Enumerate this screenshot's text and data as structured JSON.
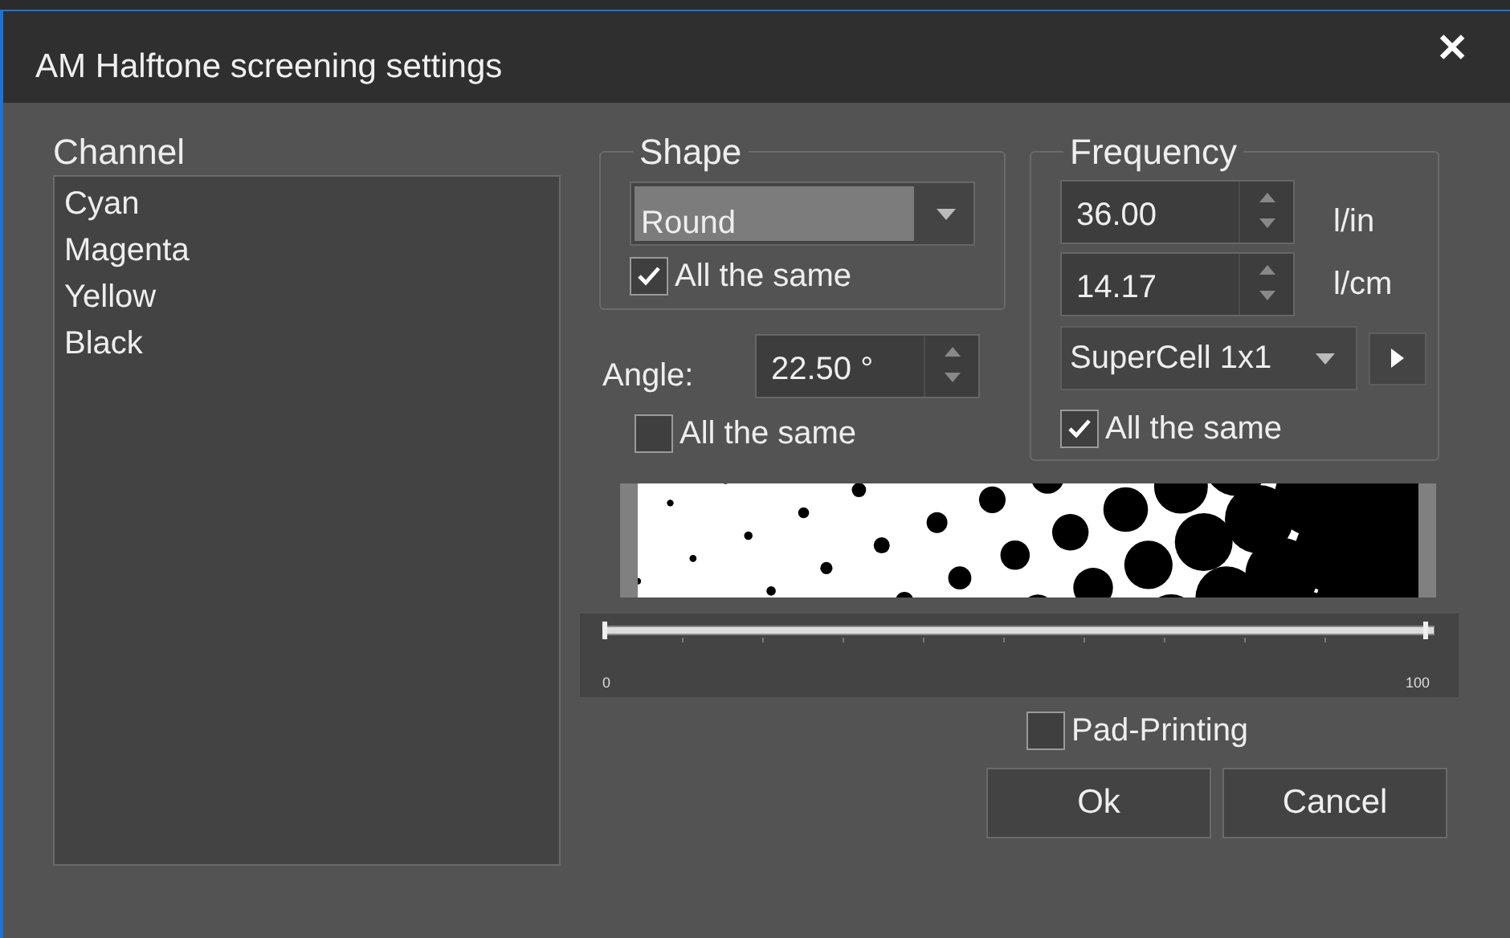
{
  "window": {
    "title": "AM Halftone screening settings",
    "close": "✕"
  },
  "channel": {
    "label": "Channel",
    "items": [
      {
        "label": "Cyan",
        "selected": false
      },
      {
        "label": "Magenta",
        "selected": false
      },
      {
        "label": "Yellow",
        "selected": false
      },
      {
        "label": "Black",
        "selected": false
      }
    ]
  },
  "shape": {
    "legend": "Shape",
    "value": "Round",
    "all_same": {
      "label": "All the same",
      "checked": true
    }
  },
  "angle": {
    "label": "Angle:",
    "value": "22.50 °",
    "all_same": {
      "label": "All the same",
      "checked": false
    }
  },
  "frequency": {
    "legend": "Frequency",
    "lpi": {
      "value": "36.00",
      "unit": "l/in"
    },
    "lpcm": {
      "value": "14.17",
      "unit": "l/cm"
    },
    "cell": "SuperCell 1x1",
    "all_same": {
      "label": "All the same",
      "checked": true
    }
  },
  "ruler": {
    "min": "0",
    "max": "100"
  },
  "pad_printing": {
    "label": "Pad-Printing",
    "checked": false
  },
  "buttons": [
    "Ok",
    "Cancel"
  ]
}
